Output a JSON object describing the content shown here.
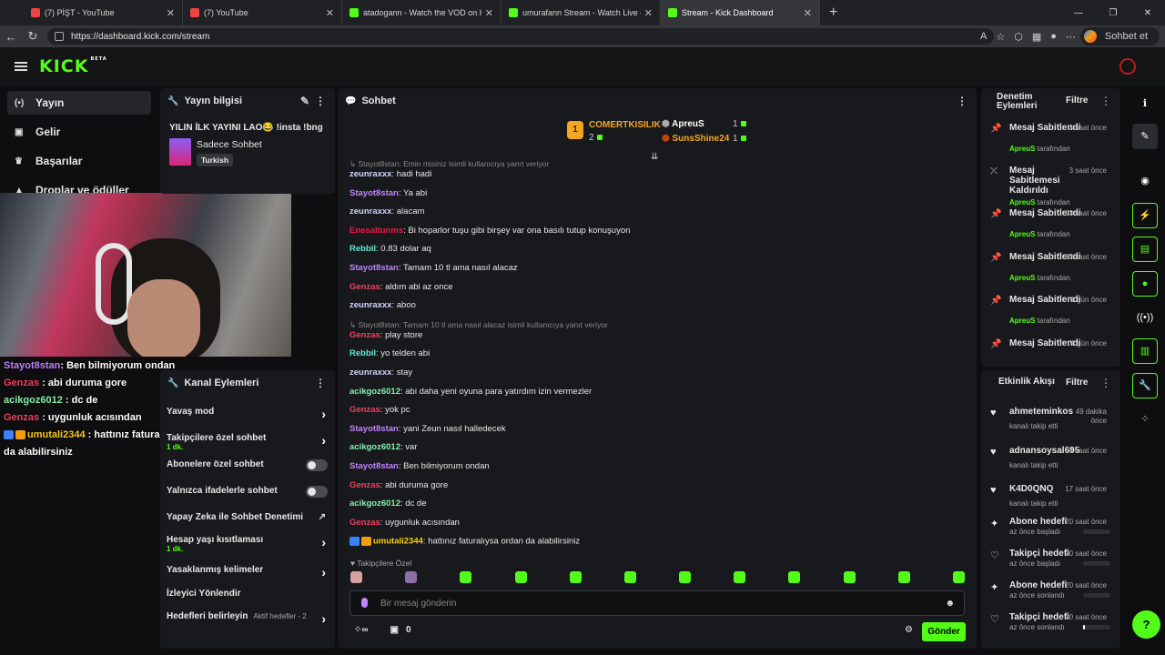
{
  "browser": {
    "tabs": [
      {
        "title": "(7) PİŞT - YouTube",
        "color": "#ef4444"
      },
      {
        "title": "(7) YouTube",
        "color": "#ef4444"
      },
      {
        "title": "atadogann - Watch the VOD on Ki",
        "color": "#53fc18"
      },
      {
        "title": "umurafann Stream - Watch Live on",
        "color": "#53fc18"
      },
      {
        "title": "Stream - Kick Dashboard",
        "color": "#53fc18"
      }
    ],
    "url": "https://dashboard.kick.com/stream",
    "profile_button": "Sohbet et"
  },
  "brand": {
    "logo": "KICK",
    "beta": "BETA",
    "accent": "#53fc18"
  },
  "nav": [
    {
      "label": "Yayın",
      "icon": "broadcast-icon"
    },
    {
      "label": "Gelir",
      "icon": "wallet-icon"
    },
    {
      "label": "Başarılar",
      "icon": "trophy-icon"
    },
    {
      "label": "Droplar ve ödüller",
      "icon": "gift-icon"
    }
  ],
  "stream_info": {
    "heading": "Yayın bilgisi",
    "title": "YILIN İLK YAYINI LAO😂 !insta !bng",
    "category": "Sadece Sohbet",
    "tag": "Turkish"
  },
  "overlay_chat": [
    {
      "user": "Stayot8stan",
      "text": ": Ben bilmiyorum ondan",
      "cls": "u-s"
    },
    {
      "user": "Genzas",
      "text": " : abi duruma gore",
      "cls": "u-g"
    },
    {
      "user": "acikgoz6012",
      "text": " : dc de",
      "cls": "u-a"
    },
    {
      "user": "Genzas",
      "text": " : uygunluk acısından",
      "cls": "u-g"
    },
    {
      "user": "umutali2344",
      "text": " : hattınız faturalıysa ordan da alabilirsiniz",
      "cls": "u-u"
    }
  ],
  "channel_actions": {
    "heading": "Kanal Eylemleri",
    "items": [
      {
        "label": "Yavaş mod",
        "control": "chevron"
      },
      {
        "label": "Takipçilere özel sohbet",
        "sub": "1 dk.",
        "control": "chevron"
      },
      {
        "label": "Abonelere özel sohbet",
        "control": "toggle"
      },
      {
        "label": "Yalnızca ifadelerle sohbet",
        "control": "toggle"
      },
      {
        "label": "Yapay Zeka ile Sohbet Denetimi",
        "control": "external"
      },
      {
        "label": "Hesap yaşı kısıtlaması",
        "sub": "1 dk.",
        "control": "chevron"
      },
      {
        "label": "Yasaklanmış kelimeler",
        "control": "chevron"
      },
      {
        "label": "İzleyici Yönlendir",
        "control": "none"
      },
      {
        "label": "Hedefleri belirleyin",
        "sub2": "Aktif hedefler - 2",
        "control": "chevron"
      }
    ]
  },
  "chat": {
    "heading": "Sohbet",
    "leaderboard": {
      "first": {
        "rank": "1",
        "name": "COMERTKISILIK",
        "count": "2"
      },
      "second": {
        "name": "ApreuS",
        "count": "1"
      },
      "third": {
        "name": "SunsShine24",
        "count": "1"
      }
    },
    "messages": [
      {
        "type": "reply",
        "text": "Stayot8stan: Emin misiniz isimli kullanıcıya yanıt veriyor"
      },
      {
        "user": "zeunraxxx",
        "cls": "u-z",
        "text": ": hadi hadi"
      },
      {
        "user": "Stayot8stan",
        "cls": "u-s",
        "text": ": Ya abi"
      },
      {
        "user": "zeunraxxx",
        "cls": "u-z",
        "text": ": alacam"
      },
      {
        "user": "Enesaltunms",
        "cls": "u-e",
        "text": ": Bi hoparlor tuşu gibi birşey var ona basılı tutup konuşuyon"
      },
      {
        "user": "Rebbil",
        "cls": "u-r",
        "text": ": 0.83 dolar aq"
      },
      {
        "user": "Stayot8stan",
        "cls": "u-s",
        "text": ": Tamam 10 tl ama nasıl alacaz"
      },
      {
        "user": "Genzas",
        "cls": "u-g",
        "text": ": aldım abi az once"
      },
      {
        "user": "zeunraxxx",
        "cls": "u-z",
        "text": ": aboo"
      },
      {
        "type": "reply",
        "text": "Stayot8stan: Tamam 10 tl ama nasıl alacaz isimli kullanıcıya yanıt veriyor"
      },
      {
        "user": "Genzas",
        "cls": "u-g",
        "text": ": play store"
      },
      {
        "user": "Rebbil",
        "cls": "u-r",
        "text": ": yo telden abi"
      },
      {
        "user": "zeunraxxx",
        "cls": "u-z",
        "text": ": stay"
      },
      {
        "user": "acikgoz6012",
        "cls": "u-a",
        "text": ": abi daha yeni oyuna para yatırdım izin vermezler"
      },
      {
        "user": "Genzas",
        "cls": "u-g",
        "text": ": yok pc"
      },
      {
        "user": "Stayot8stan",
        "cls": "u-s",
        "text": ": yani Zeun nasıl halledecek"
      },
      {
        "user": "acikgoz6012",
        "cls": "u-a",
        "text": ": var"
      },
      {
        "user": "Stayot8stan",
        "cls": "u-s",
        "text": ": Ben bilmiyorum ondan"
      },
      {
        "user": "Genzas",
        "cls": "u-g",
        "text": ": abi duruma gore"
      },
      {
        "user": "acikgoz6012",
        "cls": "u-a",
        "text": ": dc de"
      },
      {
        "user": "Genzas",
        "cls": "u-g",
        "text": ": uygunluk acısından"
      },
      {
        "user": "umutali2344",
        "cls": "u-u",
        "text": ": hattınız faturalıysa ordan da alabilirsiniz",
        "badges": true
      }
    ],
    "followers_label": "♥ Takipçilere Özel",
    "input_placeholder": "Bir mesaj gönderin",
    "points": "0",
    "send": "Gönder"
  },
  "mod_actions": {
    "heading_line1": "Denetim",
    "heading_line2": "Eylemleri",
    "filter": "Filtre",
    "items": [
      {
        "title": "Mesaj Sabitlendi",
        "time": "3 saat önce",
        "by": "ApreuS",
        "suffix": " tarafından"
      },
      {
        "title": "Mesaj Sabitlemesi Kaldırıldı",
        "time": "3 saat önce",
        "by": "ApreuS",
        "suffix": " tarafından"
      },
      {
        "title": "Mesaj Sabitlendi",
        "time": "23 saat önce",
        "by": "ApreuS",
        "suffix": " tarafından"
      },
      {
        "title": "Mesaj Sabitlendi",
        "time": "23 saat önce",
        "by": "ApreuS",
        "suffix": " tarafından"
      },
      {
        "title": "Mesaj Sabitlendi",
        "time": "1 gün önce",
        "by": "ApreuS",
        "suffix": " tarafından"
      },
      {
        "title": "Mesaj Sabitlendi",
        "time": "1 gün önce",
        "by": "",
        "suffix": ""
      }
    ]
  },
  "activity_feed": {
    "heading": "Etkinlik Akışı",
    "filter": "Filtre",
    "items": [
      {
        "icon": "heart-icon",
        "title": "ahmeteminkos",
        "time": "49 dakika önce",
        "sub": "kanalı takip etti"
      },
      {
        "icon": "heart-icon",
        "title": "adnansoysal695",
        "time": "4 saat önce",
        "sub": "kanalı takip etti"
      },
      {
        "icon": "heart-icon",
        "title": "K4D0QNQ",
        "time": "17 saat önce",
        "sub": "kanalı takip etti"
      },
      {
        "icon": "sparkle-icon",
        "title": "Abone hedefi",
        "time": "20 saat önce",
        "sub": "az önce başladı",
        "progress": 0
      },
      {
        "icon": "heart-outline-icon",
        "title": "Takipçi hedefi",
        "time": "20 saat önce",
        "sub": "az önce başladı",
        "progress": 0
      },
      {
        "icon": "sparkle-icon",
        "title": "Abone hedefi",
        "time": "20 saat önce",
        "sub": "az önce sonlandı",
        "progress": 0
      },
      {
        "icon": "heart-outline-icon",
        "title": "Takipçi hedefi",
        "time": "20 saat önce",
        "sub": "az önce sonlandı",
        "progress": 0.05
      }
    ]
  }
}
